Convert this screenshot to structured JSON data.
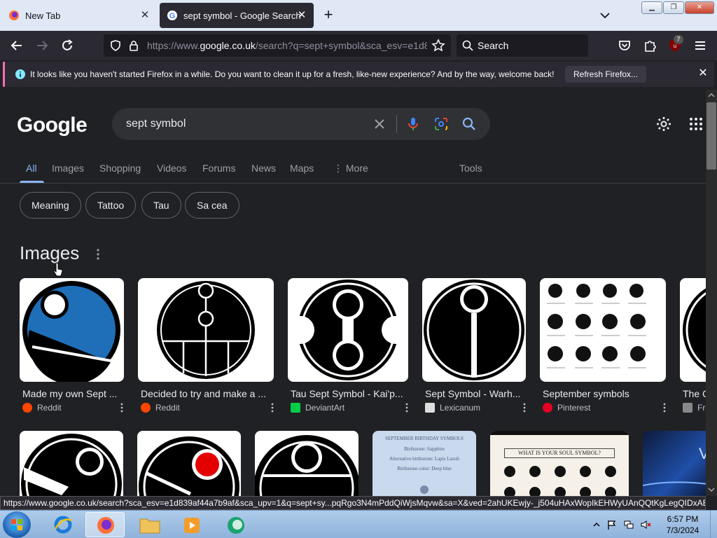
{
  "browser": {
    "tabs": [
      {
        "title": "New Tab",
        "active": false
      },
      {
        "title": "sept symbol - Google Search",
        "active": true
      }
    ],
    "url_prefix": "https://www.",
    "url_domain": "google.co.uk",
    "url_rest": "/search?q=sept+symbol&sca_esv=e1d8",
    "search_placeholder": "Search",
    "extension_badge": "7",
    "notification": {
      "message": "It looks like you haven't started Firefox in a while. Do you want to clean it up for a fresh, like-new experience? And by the way, welcome back!",
      "button": "Refresh Firefox..."
    },
    "status_url": "https://www.google.co.uk/search?sca_esv=e1d839af44a7b9af&sca_upv=1&q=sept+sy...pqRgo3N4mPddQiWjsMqvw&sa=X&ved=2ahUKEwjy-_j504uHAxWopIkEHWyUAnQQtKgLegQIDxAB"
  },
  "google": {
    "logo": "Google",
    "query": "sept symbol",
    "tabs": [
      "All",
      "Images",
      "Shopping",
      "Videos",
      "Forums",
      "News",
      "Maps",
      "More",
      "Tools"
    ],
    "active_tab": "All",
    "chips": [
      "Meaning",
      "Tattoo",
      "Tau",
      "Sa cea"
    ],
    "images_heading": "Images",
    "results": [
      {
        "title": "Made my own Sept ...",
        "source": "Reddit"
      },
      {
        "title": "Decided to try and make a ...",
        "source": "Reddit"
      },
      {
        "title": "Tau Sept Symbol - Kai'p...",
        "source": "DeviantArt"
      },
      {
        "title": "Sept Symbol - Warh...",
        "source": "Lexicanum"
      },
      {
        "title": "September symbols",
        "source": "Pinterest"
      },
      {
        "title": "The C",
        "source": "Fr"
      }
    ],
    "row2_texts": {
      "birthday_title": "SEPTEMBER BIRTHDAY SYMBOLS",
      "birthstone": "Birthstone: Sapphire",
      "alt_birthstone": "Alternative birthstone: Lapis Lazuli",
      "birthday_color": "Birthstone color: Deep blue",
      "soul_title": "WHAT IS YOUR SOUL SYMBOL?"
    }
  },
  "colors": {
    "accent": "#8ab4f8",
    "page_bg": "#202124",
    "reddit": "#ff4500",
    "deviantart": "#05cc47",
    "pinterest": "#e60023"
  },
  "taskbar": {
    "time": "6:57 PM",
    "date": "7/3/2024"
  }
}
